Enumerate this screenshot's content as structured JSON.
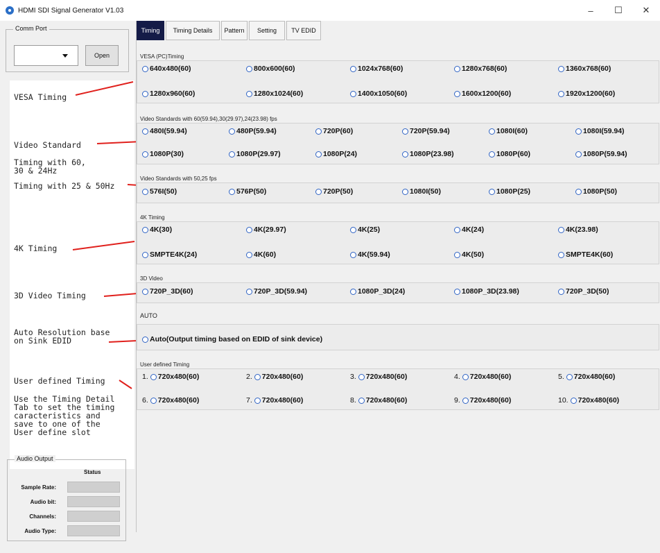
{
  "window": {
    "title": "HDMI SDI Signal Generator V1.03",
    "min": "–",
    "max": "☐",
    "close": "✕"
  },
  "comm_port": {
    "label": "Comm Port",
    "open_label": "Open",
    "selected": ""
  },
  "annotations": {
    "vesa": "VESA Timing",
    "video_standard": "Video Standard",
    "timing_60": "Timing with 60,\n30 & 24Hz",
    "timing_25": "Timing with 25 & 50Hz",
    "k4": "4K Timing",
    "video3d": "3D Video Timing",
    "auto": "Auto Resolution base\non Sink EDID",
    "user_defined": "User defined Timing",
    "user_note": "Use the Timing Detail\nTab to set the timing\ncaracteristics and\nsave to one of the\nUser define slot"
  },
  "audio": {
    "label": "Audio Output",
    "status_header": "Status",
    "rows": [
      "Sample Rate:",
      "Audio bit:",
      "Channels:",
      "Audio Type:"
    ]
  },
  "tabs": [
    "Timing",
    "Timing Details",
    "Pattern",
    "Setting",
    "TV EDID"
  ],
  "sections": {
    "vesa": {
      "label": "VESA (PC)Timing",
      "row1": [
        "640x480(60)",
        "800x600(60)",
        "1024x768(60)",
        "1280x768(60)",
        "1360x768(60)"
      ],
      "row2": [
        "1280x960(60)",
        "1280x1024(60)",
        "1400x1050(60)",
        "1600x1200(60)",
        "1920x1200(60)"
      ]
    },
    "video60": {
      "label": "Video Standards with 60(59.94),30(29.97),24(23.98) fps",
      "row1": [
        "480I(59.94)",
        "480P(59.94)",
        "720P(60)",
        "720P(59.94)",
        "1080I(60)",
        "1080I(59.94)"
      ],
      "row2": [
        "1080P(30)",
        "1080P(29.97)",
        "1080P(24)",
        "1080P(23.98)",
        "1080P(60)",
        "1080P(59.94)"
      ]
    },
    "video50": {
      "label": "Video Standards with 50,25 fps",
      "row1": [
        "576I(50)",
        "576P(50)",
        "720P(50)",
        "1080I(50)",
        "1080P(25)",
        "1080P(50)"
      ]
    },
    "k4": {
      "label": "4K Timing",
      "row1": [
        "4K(30)",
        "4K(29.97)",
        "4K(25)",
        "4K(24)",
        "4K(23.98)"
      ],
      "row2": [
        "SMPTE4K(24)",
        "4K(60)",
        "4K(59.94)",
        "4K(50)",
        "SMPTE4K(60)"
      ]
    },
    "video3d": {
      "label": "3D Video",
      "row1": [
        "720P_3D(60)",
        "720P_3D(59.94)",
        "1080P_3D(24)",
        "1080P_3D(23.98)",
        "720P_3D(50)"
      ]
    },
    "auto": {
      "label": "AUTO",
      "option": "Auto(Output timing based on EDID of sink device)"
    },
    "user": {
      "label": "User defined Timing",
      "row1": [
        {
          "n": "1.",
          "t": "720x480(60)"
        },
        {
          "n": "2.",
          "t": "720x480(60)"
        },
        {
          "n": "3.",
          "t": "720x480(60)"
        },
        {
          "n": "4.",
          "t": "720x480(60)"
        },
        {
          "n": "5.",
          "t": "720x480(60)"
        }
      ],
      "row2": [
        {
          "n": "6.",
          "t": "720x480(60)"
        },
        {
          "n": "7.",
          "t": "720x480(60)"
        },
        {
          "n": "8.",
          "t": "720x480(60)"
        },
        {
          "n": "9.",
          "t": "720x480(60)"
        },
        {
          "n": "10.",
          "t": "720x480(60)"
        }
      ]
    }
  },
  "colors": {
    "active_tab": "#141b47",
    "annotation_line": "#e0201c",
    "radio_ring": "#2f63c4"
  }
}
